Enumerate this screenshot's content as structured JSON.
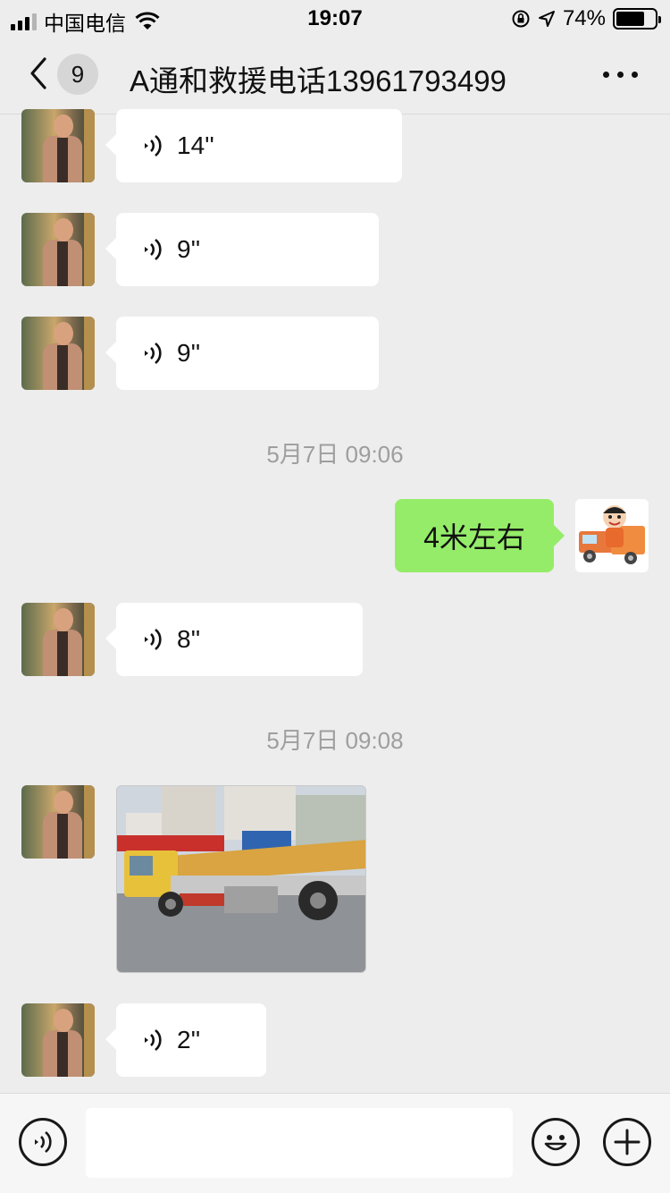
{
  "status_bar": {
    "carrier": "中国电信",
    "time": "19:07",
    "battery": "74%",
    "battery_level": 0.74,
    "icons": [
      "signal-icon",
      "wifi-icon",
      "orientation-lock-icon",
      "location-arrow-icon",
      "battery-icon"
    ]
  },
  "nav": {
    "unread_count": "9",
    "title": "A通和救援电话13961793499",
    "icons": [
      "back-chevron-icon",
      "more-icon"
    ]
  },
  "messages": [
    {
      "type": "voice",
      "from": "contact",
      "duration": "14''"
    },
    {
      "type": "voice",
      "from": "contact",
      "duration": "9''"
    },
    {
      "type": "voice",
      "from": "contact",
      "duration": "9''"
    },
    {
      "type": "timestamp",
      "text": "5月7日 09:06"
    },
    {
      "type": "text",
      "from": "me",
      "text": "4米左右"
    },
    {
      "type": "voice",
      "from": "contact",
      "duration": "8''"
    },
    {
      "type": "timestamp",
      "text": "5月7日 09:08"
    },
    {
      "type": "image",
      "from": "contact",
      "content": "yellow-tow-truck-photo"
    },
    {
      "type": "voice",
      "from": "contact",
      "duration": "2''"
    }
  ],
  "input_bar": {
    "placeholder": "",
    "icons": [
      "voice-mode-icon",
      "emoji-icon",
      "plus-icon"
    ]
  },
  "colors": {
    "background": "#ededed",
    "my_bubble": "#95ec69",
    "contact_bubble": "#ffffff",
    "timestamp_text": "#9e9e9e"
  }
}
